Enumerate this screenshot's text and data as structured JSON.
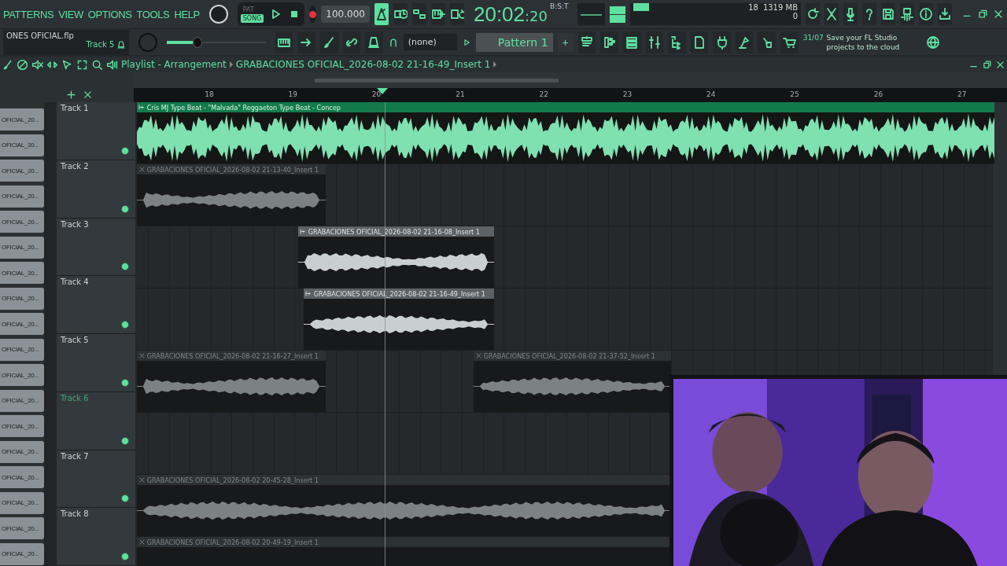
{
  "top_bar": {
    "menu": [
      "PATTERNS",
      "VIEW",
      "OPTIONS",
      "TOOLS",
      "HELP"
    ],
    "pat_song": [
      {
        "label": "PAT",
        "selected": false
      },
      {
        "label": "SONG",
        "selected": true
      }
    ],
    "tempo": "100.000",
    "toggles": [
      {
        "on": true
      },
      {
        "on": false
      },
      {
        "on": false
      },
      {
        "on": false
      },
      {
        "on": false
      }
    ],
    "time": "20:02",
    "seconds": ":20",
    "time_unit": "B:S:T",
    "cpu": "18",
    "memory": "1319 MB",
    "polyphony": "0"
  },
  "second_bar": {
    "file": "ONES OFICIAL.flp",
    "track": "Track 5",
    "master_volume": {
      "level": 0.3
    },
    "snap": "(none)",
    "pattern": "Pattern 1",
    "add": "+",
    "news": {
      "date": "31/07",
      "text": "Save your FL Studio projects to the cloud"
    }
  },
  "playlist": {
    "title": "Playlist - Arrangement",
    "clip_name": "GRABACIONES OFICIAL_2026-08-02 21-16-49_Insert 1",
    "ruler": [
      "18",
      "19",
      "20",
      "21",
      "22",
      "23",
      "24",
      "25",
      "26",
      "27"
    ],
    "channels": [
      "OFICIAL_20...",
      "OFICIAL_20...",
      "OFICIAL_20...",
      "OFICIAL_20...",
      "OFICIAL_20...",
      "OFICIAL_20...",
      "OFICIAL_20...",
      "OFICIAL_20...",
      "OFICIAL_20...",
      "OFICIAL_20...",
      "OFICIAL_20...",
      "OFICIAL_20...",
      "OFICIAL_20...",
      "OFICIAL_20...",
      "OFICIAL_20...",
      "OFICIAL_20...",
      "OFICIAL_20...",
      "OFICIAL_20..."
    ],
    "tracks": [
      {
        "name": "Track 1",
        "selected": false,
        "on": true,
        "clips": [
          {
            "kind": "beat",
            "label": "Cris MJ Type Beat - \"Malvada\"  Reggaeton Type Beat - Concep",
            "selected": true
          }
        ]
      },
      {
        "name": "Track 2",
        "selected": false,
        "on": true,
        "clips": [
          {
            "kind": "recording",
            "label": "GRABACIONES OFICIAL_2026-08-02 21-13-40_Insert 1",
            "selected": false
          }
        ]
      },
      {
        "name": "Track 3",
        "selected": false,
        "on": true,
        "clips": [
          {
            "kind": "recording",
            "label": "GRABACIONES OFICIAL_2026-08-02 21-16-08_Insert 1",
            "selected": true
          }
        ]
      },
      {
        "name": "Track 4",
        "selected": false,
        "on": true,
        "clips": [
          {
            "kind": "recording",
            "label": "GRABACIONES OFICIAL_2026-08-02 21-16-49_Insert 1",
            "selected": true
          }
        ]
      },
      {
        "name": "Track 5",
        "selected": false,
        "on": true,
        "clips": [
          {
            "kind": "recording",
            "label": "GRABACIONES OFICIAL_2026-08-02 21-16-27_Insert 1",
            "selected": false
          },
          {
            "kind": "recording",
            "label": "GRABACIONES OFICIAL_2026-08-02 21-37-52_Insert 1",
            "selected": false
          }
        ]
      },
      {
        "name": "Track 6",
        "selected": true,
        "on": true
      },
      {
        "name": "Track 7",
        "selected": false,
        "on": true,
        "clips": [
          {
            "kind": "recording",
            "label": "GRABACIONES OFICIAL_2026-08-02 20-45-28_Insert 1",
            "selected": false
          }
        ]
      },
      {
        "name": "Track 8",
        "selected": false,
        "on": true,
        "clips": [
          {
            "kind": "recording",
            "label": "GRABACIONES OFICIAL_2026-08-02 20-49-19_Insert 1",
            "selected": false
          }
        ]
      }
    ]
  }
}
